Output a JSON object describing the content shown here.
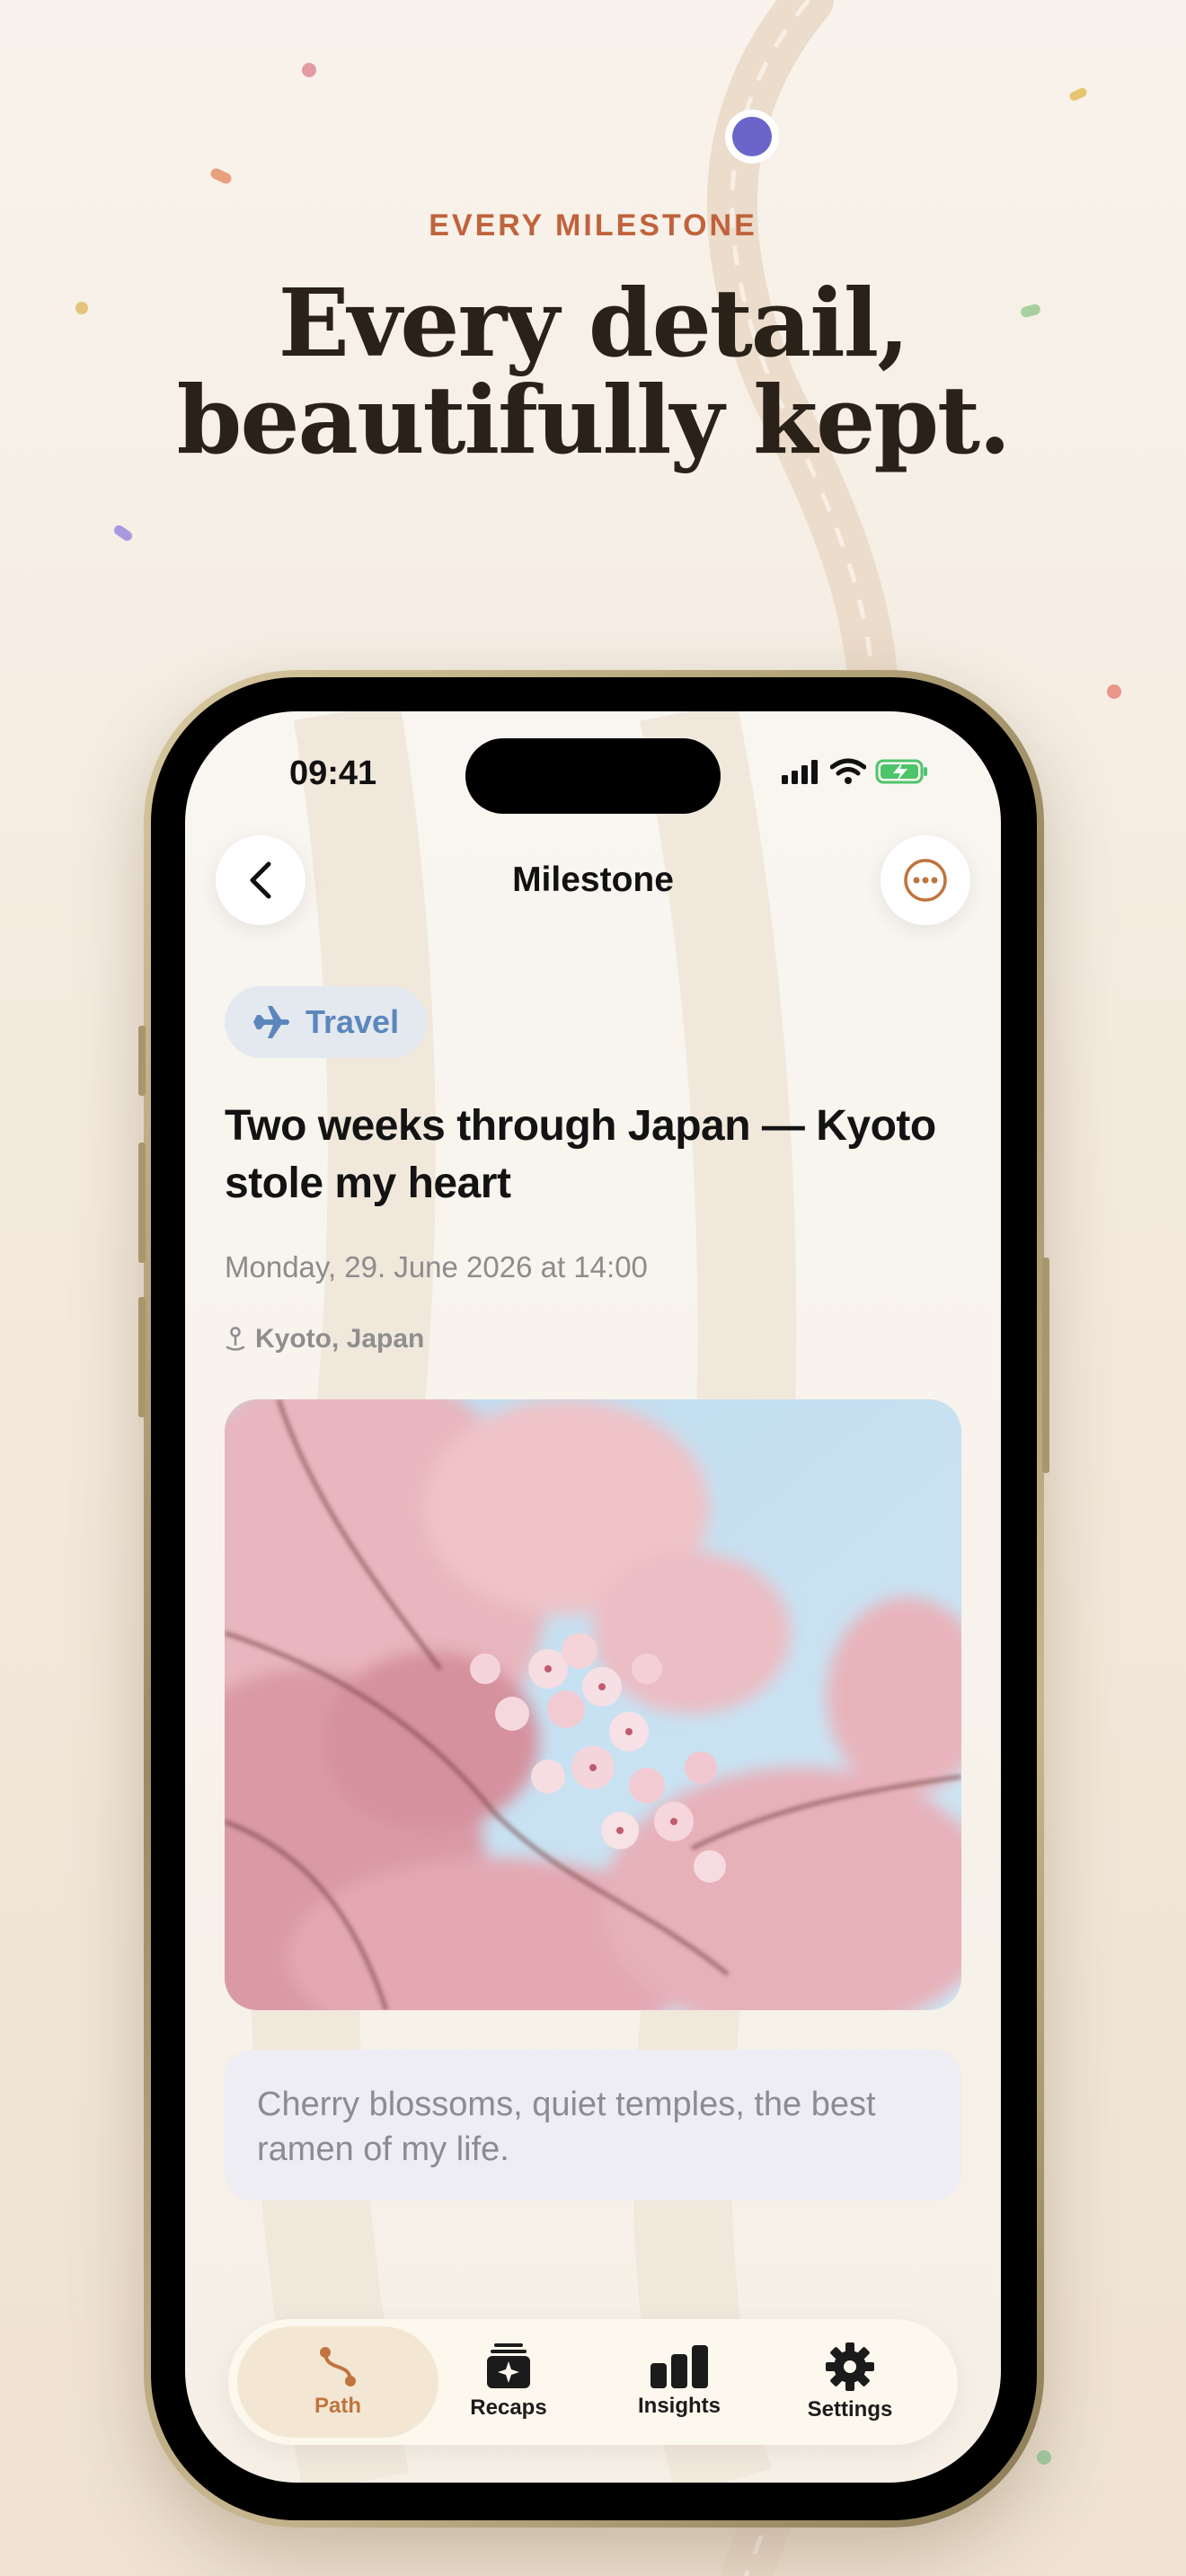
{
  "header": {
    "eyebrow": "EVERY MILESTONE",
    "headline_line1": "Every detail,",
    "headline_line2": "beautifully kept."
  },
  "status_bar": {
    "time": "09:41"
  },
  "nav": {
    "title": "Milestone"
  },
  "milestone": {
    "category": "Travel",
    "title": "Two weeks through Japan — Kyoto stole my heart",
    "date": "Monday, 29. June 2026 at 14:00",
    "location": "Kyoto, Japan",
    "note": "Cherry blossoms, quiet temples, the best ramen of my life."
  },
  "tabs": [
    {
      "label": "Path",
      "icon": "path-icon",
      "active": true
    },
    {
      "label": "Recaps",
      "icon": "recaps-icon",
      "active": false
    },
    {
      "label": "Insights",
      "icon": "insights-icon",
      "active": false
    },
    {
      "label": "Settings",
      "icon": "gear-icon",
      "active": false
    }
  ],
  "colors": {
    "accent": "#c0633d",
    "travel_chip_text": "#5b87bd",
    "travel_chip_bg": "#e4e9ef",
    "marker": "#6b64c9"
  }
}
